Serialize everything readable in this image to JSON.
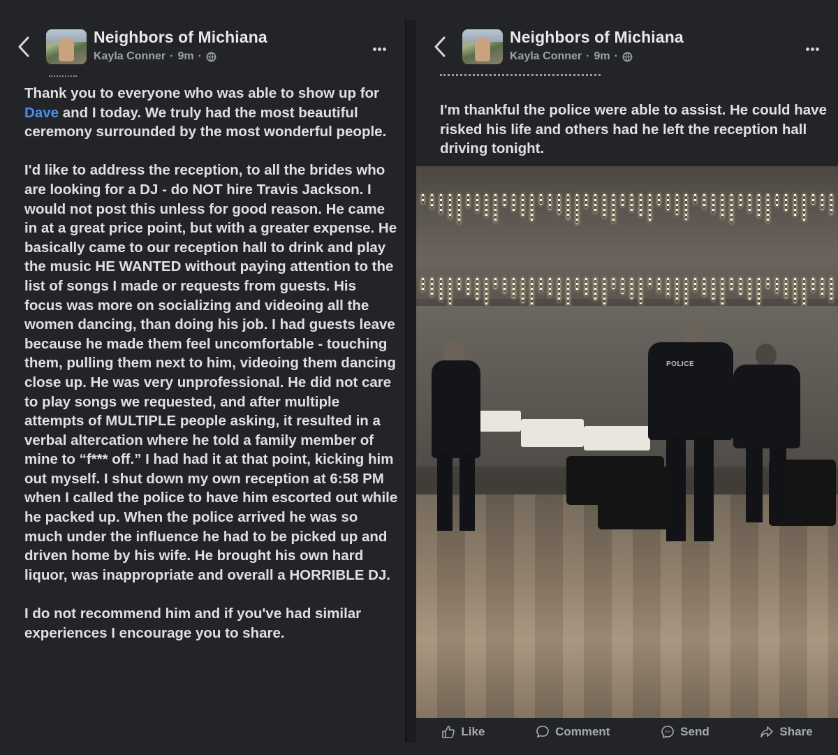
{
  "posts": [
    {
      "group_name": "Neighbors of Michiana",
      "author": "Kayla Conner",
      "time": "9m",
      "paragraph1_before": "Thank you to everyone who was able to show up for ",
      "mention": "Dave",
      "paragraph1_after": " and I today. We truly had the most beautiful ceremony surrounded by the most wonderful people.",
      "paragraph2": "I'd like to address the reception, to all the brides who are looking for a DJ - do NOT hire Travis Jackson. I would not post this unless for good reason. He came in at a great price point, but with a greater expense. He basically came to our reception hall to drink and play the music HE WANTED without paying attention to the list of songs I made or requests from guests. His focus was more on socializing and videoing all the women dancing, than doing his job. I had guests leave because he made them feel uncomfortable - touching them, pulling them next to him, videoing them dancing close up. He was very unprofessional. He did not care to play songs we requested, and after multiple attempts of MULTIPLE people asking, it resulted in a verbal altercation where he told a family member of mine to “f*** off.” I had had it at that point, kicking him out myself. I shut down my own reception at 6:58 PM when I called the police to have him escorted out while he packed up. When the police arrived he was so much under the influence he had to be picked up and driven home by his wife. He brought his own hard liquor, was inappropriate and overall a HORRIBLE DJ.",
      "paragraph3": "I do not recommend him and if you've had similar experiences I encourage you to share."
    },
    {
      "group_name": "Neighbors of Michiana",
      "author": "Kayla Conner",
      "time": "9m",
      "paragraph1": "I'm thankful the police were able to assist. He could have risked his life and others had he left the reception hall driving tonight.",
      "photo_label": "POLICE"
    }
  ],
  "actions": {
    "like": "Like",
    "comment": "Comment",
    "send": "Send",
    "share": "Share"
  }
}
